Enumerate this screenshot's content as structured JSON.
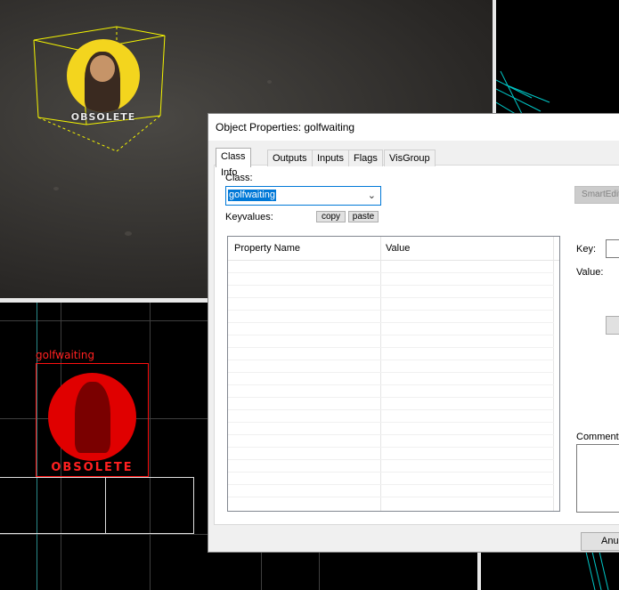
{
  "viewport_3d": {
    "entity_icon": "obsolete-entity-sprite",
    "entity_caption": "OBSOLETE",
    "selection_color": "#f5f500"
  },
  "viewport_2d": {
    "entity_label": "golfwaiting",
    "entity_caption": "OBSOLETE",
    "entity_color": "#ff1010"
  },
  "dialog": {
    "title": "Object Properties: golfwaiting",
    "tabs": [
      {
        "label": "Class Info",
        "active": true
      },
      {
        "label": "Outputs",
        "active": false
      },
      {
        "label": "Inputs",
        "active": false
      },
      {
        "label": "Flags",
        "active": false
      },
      {
        "label": "VisGroup",
        "active": false
      }
    ],
    "class_label": "Class:",
    "class_value": "golfwaiting",
    "keyvalues_label": "Keyvalues:",
    "copy_label": "copy",
    "paste_label": "paste",
    "smartedit_label": "SmartEdit",
    "table": {
      "columns": [
        "Property Name",
        "Value"
      ],
      "rows": []
    },
    "key_label": "Key:",
    "value_label": "Value:",
    "comments_label": "Comments",
    "cancel_label": "Anul"
  },
  "colors": {
    "accent": "#0078d7",
    "grid_cyan": "#00c8c8"
  }
}
